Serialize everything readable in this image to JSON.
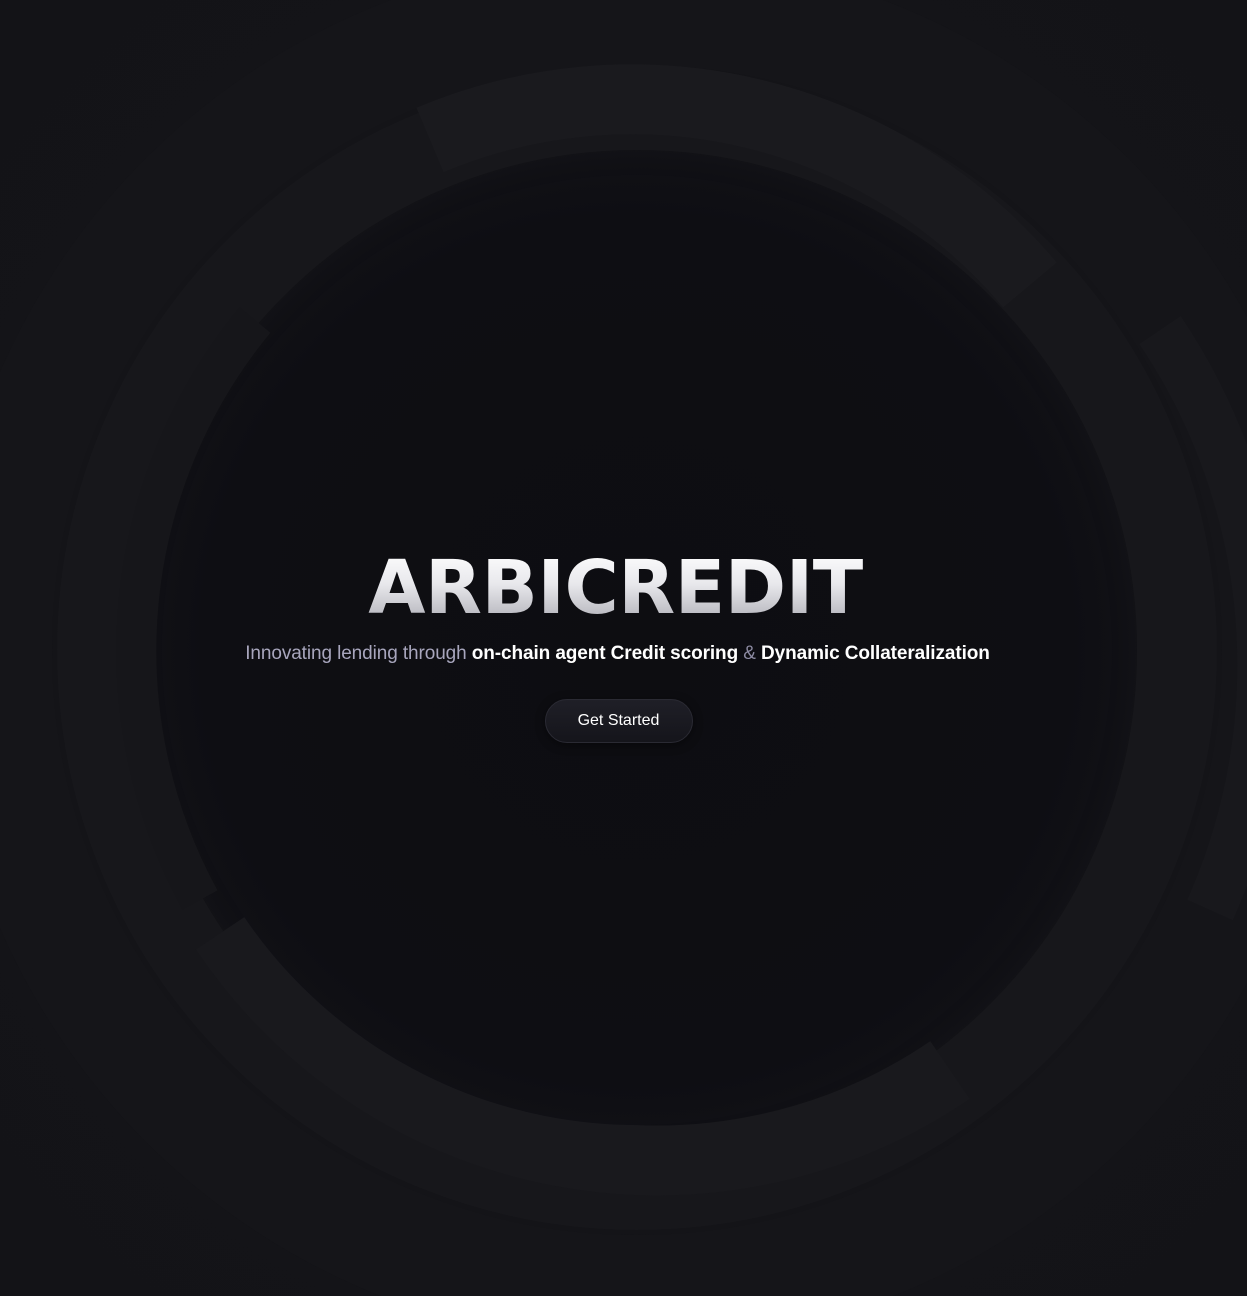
{
  "hero": {
    "title": "ARBICREDIT",
    "tagline": {
      "part1": "Innovating lending through",
      "part2": "on-chain agent Credit scoring",
      "part3": "&",
      "part4": "Dynamic Collateralization"
    },
    "cta_label": "Get Started"
  },
  "colors": {
    "background": "#121216",
    "inner_circle": "#0d0d12",
    "ring": "#18181c",
    "muted_text": "#a8a6bd",
    "strong_text": "#ffffff"
  }
}
